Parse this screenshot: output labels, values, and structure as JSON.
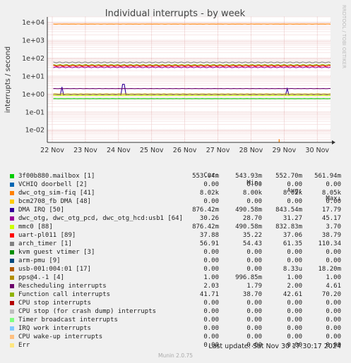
{
  "chart_data": {
    "type": "line",
    "title": "Individual interrupts - by week",
    "ylabel": "interrupts / second",
    "y_scale": "log",
    "ylim": [
      0.002,
      20000
    ],
    "y_ticks": [
      {
        "value": 10000,
        "label": "1e+04"
      },
      {
        "value": 1000,
        "label": "1e+03"
      },
      {
        "value": 100,
        "label": "1e+02"
      },
      {
        "value": 10,
        "label": "1e+01"
      },
      {
        "value": 1,
        "label": "1e+00"
      },
      {
        "value": 0.1,
        "label": "1e-01"
      },
      {
        "value": 0.01,
        "label": "1e-02"
      }
    ],
    "x_ticks": [
      {
        "value": 0,
        "label": "22 Nov"
      },
      {
        "value": 1,
        "label": "23 Nov"
      },
      {
        "value": 2,
        "label": "24 Nov"
      },
      {
        "value": 3,
        "label": "25 Nov"
      },
      {
        "value": 4,
        "label": "26 Nov"
      },
      {
        "value": 5,
        "label": "27 Nov"
      },
      {
        "value": 6,
        "label": "28 Nov"
      },
      {
        "value": 7,
        "label": "29 Nov"
      },
      {
        "value": 8,
        "label": "30 Nov"
      }
    ],
    "xlim": [
      0,
      8.4
    ],
    "grid": true,
    "side_label": "RRDTOOL / TOBI OETIKER",
    "series": [
      {
        "name": "3f00b880.mailbox [1]",
        "color": "#00cc00",
        "cur": "553.04m",
        "min": "543.93m",
        "avg": "552.70m",
        "max": "561.94m",
        "level": 0.55
      },
      {
        "name": "VCHIQ doorbell [2]",
        "color": "#0066b3",
        "cur": "0.00",
        "min": "0.00",
        "avg": "0.00",
        "max": "0.00"
      },
      {
        "name": "dwc_otg_sim-fiq [41]",
        "color": "#ff8000",
        "cur": "8.02k",
        "min": "8.00k",
        "avg": "8.02k",
        "max": "8.05k",
        "level": 8020,
        "spike": {
          "x": 6.85,
          "y": 0.003
        }
      },
      {
        "name": "bcm2708_fb DMA [48]",
        "color": "#ffcc00",
        "cur": "0.00",
        "min": "0.00",
        "avg": "0.00",
        "max": "0.00"
      },
      {
        "name": "DMA IRQ [50]",
        "color": "#330099",
        "cur": "876.42m",
        "min": "490.58m",
        "avg": "843.54m",
        "max": "17.79",
        "level": 0.85,
        "spikes": [
          {
            "x": 0.3,
            "y": 2.5
          },
          {
            "x": 2.15,
            "y": 3.5
          },
          {
            "x": 7.1,
            "y": 2.0
          }
        ]
      },
      {
        "name": "dwc_otg, dwc_otg_pcd, dwc_otg_hcd:usb1 [64]",
        "color": "#990099",
        "cur": "30.26",
        "min": "28.70",
        "avg": "31.27",
        "max": "45.17",
        "level": 31
      },
      {
        "name": "mmc0 [88]",
        "color": "#ccff00",
        "cur": "876.42m",
        "min": "490.58m",
        "avg": "832.83m",
        "max": "3.70",
        "level": 0.83
      },
      {
        "name": "uart-pl011 [89]",
        "color": "#ff0000",
        "cur": "37.88",
        "min": "35.22",
        "avg": "37.06",
        "max": "38.79",
        "level": 37
      },
      {
        "name": "arch_timer [1]",
        "color": "#808080",
        "cur": "56.91",
        "min": "54.43",
        "avg": "61.35",
        "max": "110.34",
        "level": 58
      },
      {
        "name": "kvm guest vtimer [3]",
        "color": "#008f00",
        "cur": "0.00",
        "min": "0.00",
        "avg": "0.00",
        "max": "0.00"
      },
      {
        "name": "arm-pmu [9]",
        "color": "#00487d",
        "cur": "0.00",
        "min": "0.00",
        "avg": "0.00",
        "max": "0.00"
      },
      {
        "name": "usb-001:004:01 [17]",
        "color": "#b35a00",
        "cur": "0.00",
        "min": "0.00",
        "avg": "8.33u",
        "max": "18.20m"
      },
      {
        "name": "pps@4.-1 [4]",
        "color": "#b38f00",
        "cur": "1.00",
        "min": "996.85m",
        "avg": "1.00",
        "max": "1.00",
        "level": 1.0
      },
      {
        "name": "Rescheduling interrupts",
        "color": "#6b006b",
        "cur": "2.03",
        "min": "1.79",
        "avg": "2.00",
        "max": "4.61",
        "level": 2.0
      },
      {
        "name": "Function call interrupts",
        "color": "#8fb300",
        "cur": "41.71",
        "min": "38.70",
        "avg": "42.61",
        "max": "70.20",
        "level": 42
      },
      {
        "name": "CPU stop interrupts",
        "color": "#b30000",
        "cur": "0.00",
        "min": "0.00",
        "avg": "0.00",
        "max": "0.00"
      },
      {
        "name": "CPU stop (for crash dump) interrupts",
        "color": "#bebebe",
        "cur": "0.00",
        "min": "0.00",
        "avg": "0.00",
        "max": "0.00"
      },
      {
        "name": "Timer broadcast interrupts",
        "color": "#80ff80",
        "cur": "0.00",
        "min": "0.00",
        "avg": "0.00",
        "max": "0.00"
      },
      {
        "name": "IRQ work interrupts",
        "color": "#80c9ff",
        "cur": "0.00",
        "min": "0.00",
        "avg": "0.00",
        "max": "0.00"
      },
      {
        "name": "CPU wake-up interrupts",
        "color": "#ffc080",
        "cur": "0.00",
        "min": "0.00",
        "avg": "0.00",
        "max": "0.00"
      },
      {
        "name": "Err",
        "color": "#ffe680",
        "cur": "0.00",
        "min": "0.00",
        "avg": "0.00",
        "max": "0.00"
      }
    ]
  },
  "legend_header": {
    "cur": "Cur:",
    "min": "Min:",
    "avg": "Avg:",
    "max": "Max:"
  },
  "footer": {
    "last_update": "Last update: Sat Nov 30 17:30:17 2024",
    "munin": "Munin 2.0.75"
  }
}
